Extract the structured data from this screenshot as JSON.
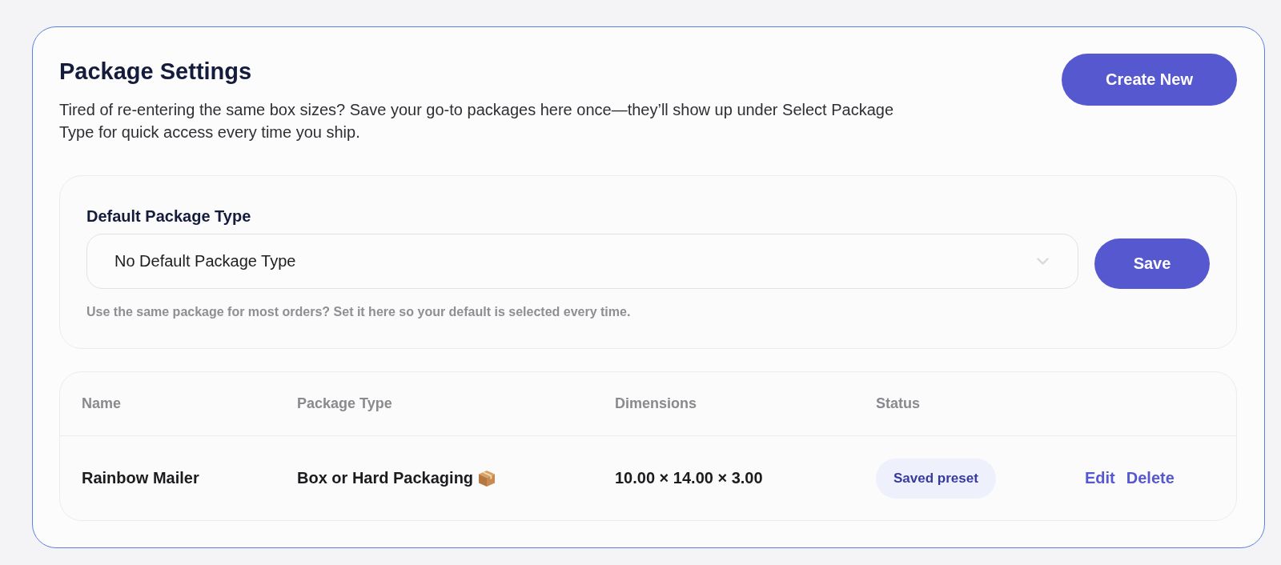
{
  "header": {
    "title": "Package Settings",
    "description": "Tired of re-entering the same box sizes? Save your go-to packages here once—they’ll show up under Select Package Type for quick access every time you ship.",
    "create_button": "Create New"
  },
  "default_package": {
    "label": "Default Package Type",
    "select": {
      "value": "No Default Package Type"
    },
    "save_button": "Save",
    "help": "Use the same package for most orders? Set it here so your default is selected every time."
  },
  "table": {
    "columns": [
      "Name",
      "Package Type",
      "Dimensions",
      "Status"
    ],
    "rows": [
      {
        "name": "Rainbow Mailer",
        "package_type": "Box or Hard Packaging",
        "dimensions": "10.00 × 14.00 × 3.00",
        "status": "Saved preset",
        "actions": [
          "Edit",
          "Delete"
        ]
      }
    ]
  }
}
